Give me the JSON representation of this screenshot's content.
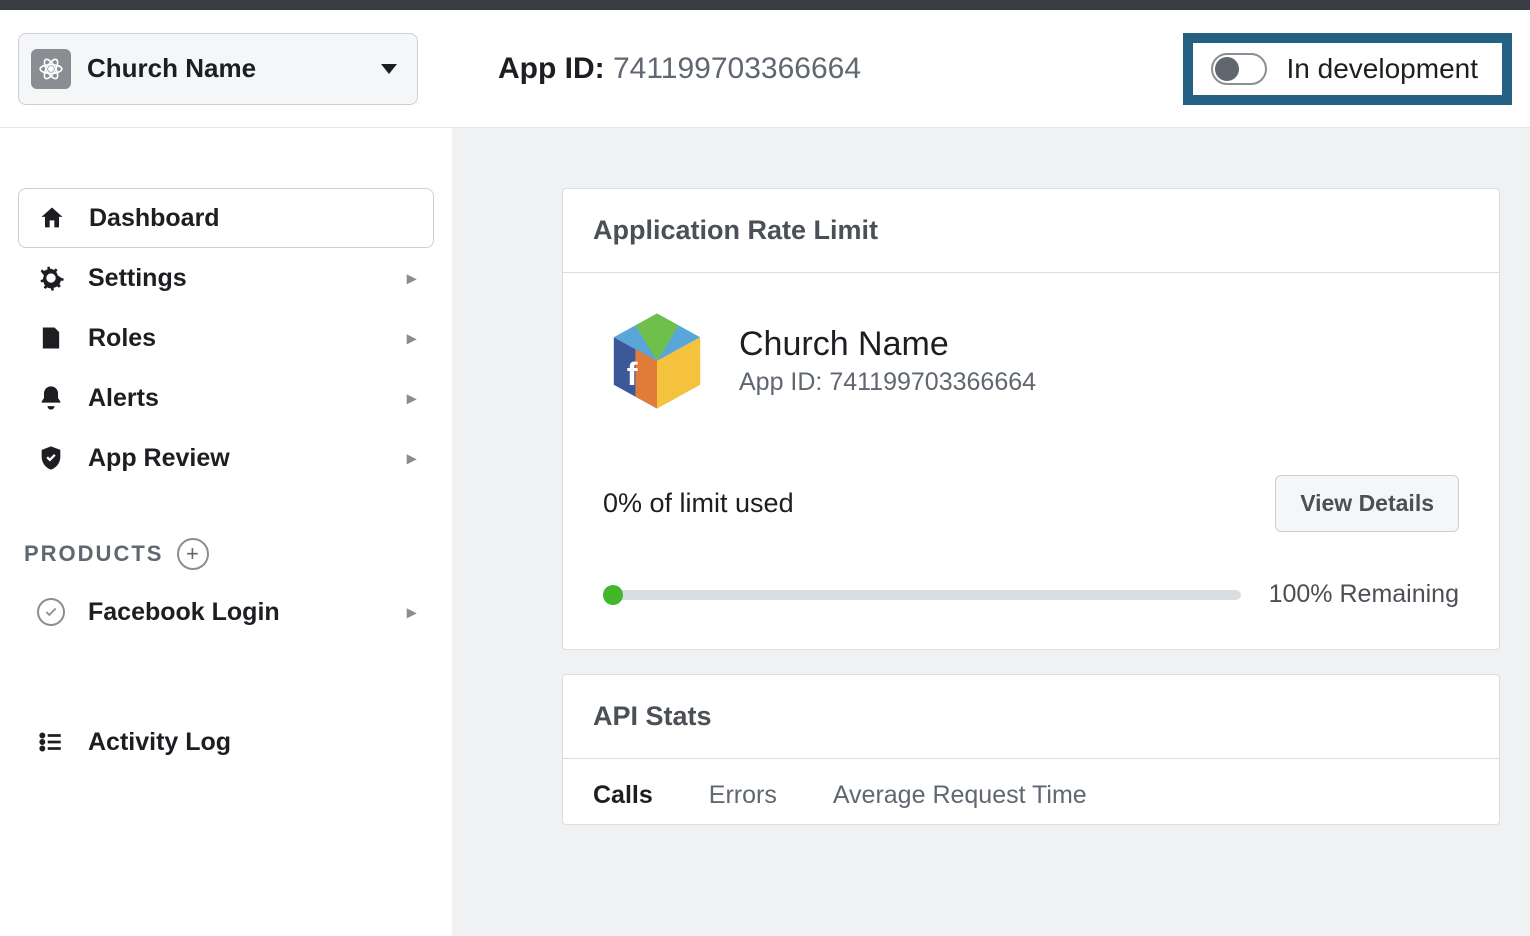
{
  "header": {
    "app_name": "Church Name",
    "app_id_label": "App ID:",
    "app_id_value": "741199703366664",
    "status_text": "In development"
  },
  "sidebar": {
    "items": [
      {
        "icon": "home-icon",
        "label": "Dashboard",
        "selected": true,
        "expandable": false
      },
      {
        "icon": "gear-icon",
        "label": "Settings",
        "selected": false,
        "expandable": true
      },
      {
        "icon": "roles-icon",
        "label": "Roles",
        "selected": false,
        "expandable": true
      },
      {
        "icon": "bell-icon",
        "label": "Alerts",
        "selected": false,
        "expandable": true
      },
      {
        "icon": "shield-icon",
        "label": "App Review",
        "selected": false,
        "expandable": true
      }
    ],
    "products_header": "PRODUCTS",
    "products": [
      {
        "icon": "check-circle-icon",
        "label": "Facebook Login",
        "expandable": true
      }
    ],
    "activity_log_label": "Activity Log"
  },
  "main": {
    "rate_card": {
      "title": "Application Rate Limit",
      "app_name": "Church Name",
      "app_id_label": "App ID:",
      "app_id_value": "741199703366664",
      "limit_used_text": "0% of limit used",
      "view_details_label": "View Details",
      "remaining_text": "100% Remaining"
    },
    "api_stats": {
      "title": "API Stats",
      "tabs": [
        "Calls",
        "Errors",
        "Average Request Time"
      ],
      "active_tab": 0
    }
  }
}
